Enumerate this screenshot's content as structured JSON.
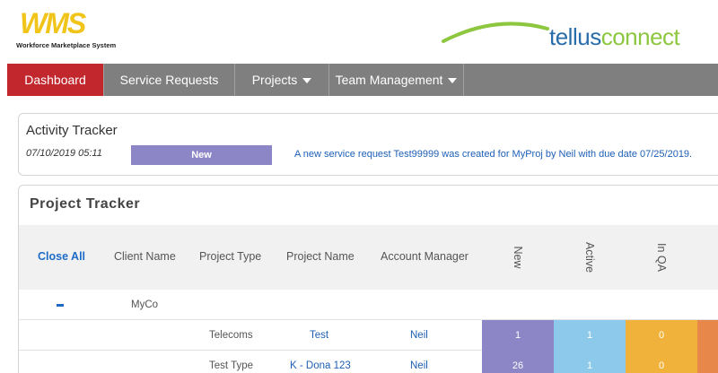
{
  "header": {
    "logo_text": "WMS",
    "logo_subtitle": "Workforce Marketplace System",
    "brand_part1": "tellus",
    "brand_part2": "connect"
  },
  "nav": {
    "items": [
      {
        "label": "Dashboard",
        "active": true
      },
      {
        "label": "Service Requests",
        "active": false
      },
      {
        "label": "Projects",
        "active": false
      },
      {
        "label": "Team Management",
        "active": false
      }
    ]
  },
  "activity": {
    "title": "Activity Tracker",
    "entries": [
      {
        "date": "07/10/2019 05:11",
        "status": "New",
        "message": "A new service request Test99999 was created for MyProj by Neil with due date 07/25/2019."
      }
    ]
  },
  "project": {
    "title": "Project Tracker",
    "columns": {
      "close_all": "Close All",
      "client_name": "Client Name",
      "project_type": "Project Type",
      "project_name": "Project Name",
      "account_manager": "Account Manager",
      "new": "New",
      "active": "Active",
      "in_qa": "In QA"
    },
    "group": {
      "collapse_symbol": "–",
      "client": "MyCo"
    },
    "rows": [
      {
        "type": "Telecoms",
        "name": "Test",
        "manager": "Neil",
        "new": "1",
        "active": "1",
        "in_qa": "0"
      },
      {
        "type": "Test Type",
        "name": "K - Dona 123",
        "manager": "Neil",
        "new": "26",
        "active": "1",
        "in_qa": "0"
      }
    ]
  },
  "colors": {
    "nav_active": "#c1272d",
    "nav_bg": "#7f7f7f",
    "status_new": "#8c86c6",
    "status_active": "#8dc9ea",
    "status_qa": "#f0b23a",
    "status_extra": "#e8874a",
    "link": "#1e5fb5"
  }
}
